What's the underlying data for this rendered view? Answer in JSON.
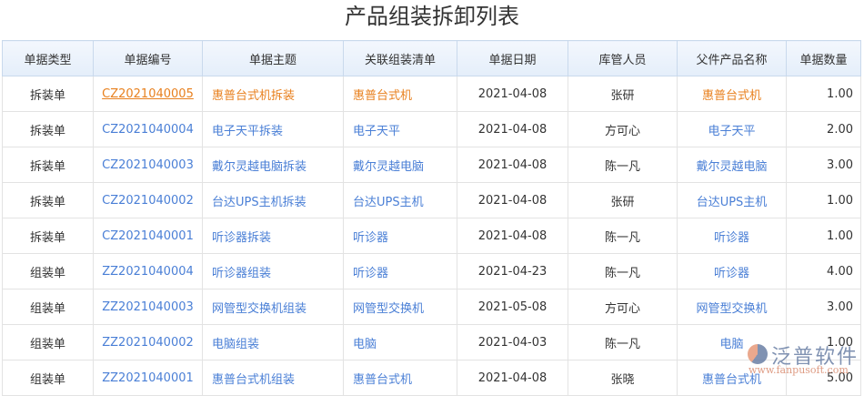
{
  "title": "产品组装拆卸列表",
  "columns": [
    "单据类型",
    "单据编号",
    "单据主题",
    "关联组装清单",
    "单据日期",
    "库管人员",
    "父件产品名称",
    "单据数量"
  ],
  "rows": [
    {
      "type": "拆装单",
      "no": "CZ2021040005",
      "subject": "惠普台式机拆装",
      "list": "惠普台式机",
      "date": "2021-04-08",
      "keeper": "张研",
      "parent": "惠普台式机",
      "qty": "1.00",
      "highlight": true
    },
    {
      "type": "拆装单",
      "no": "CZ2021040004",
      "subject": "电子天平拆装",
      "list": "电子天平",
      "date": "2021-04-08",
      "keeper": "方可心",
      "parent": "电子天平",
      "qty": "2.00"
    },
    {
      "type": "拆装单",
      "no": "CZ2021040003",
      "subject": "戴尔灵越电脑拆装",
      "list": "戴尔灵越电脑",
      "date": "2021-04-08",
      "keeper": "陈一凡",
      "parent": "戴尔灵越电脑",
      "qty": "3.00"
    },
    {
      "type": "拆装单",
      "no": "CZ2021040002",
      "subject": "台达UPS主机拆装",
      "list": "台达UPS主机",
      "date": "2021-04-08",
      "keeper": "张研",
      "parent": "台达UPS主机",
      "qty": "1.00"
    },
    {
      "type": "拆装单",
      "no": "CZ2021040001",
      "subject": "听诊器拆装",
      "list": "听诊器",
      "date": "2021-04-08",
      "keeper": "陈一凡",
      "parent": "听诊器",
      "qty": "1.00"
    },
    {
      "type": "组装单",
      "no": "ZZ2021040004",
      "subject": "听诊器组装",
      "list": "听诊器",
      "date": "2021-04-23",
      "keeper": "陈一凡",
      "parent": "听诊器",
      "qty": "4.00"
    },
    {
      "type": "组装单",
      "no": "ZZ2021040003",
      "subject": "网管型交换机组装",
      "list": "网管型交换机",
      "date": "2021-05-08",
      "keeper": "方可心",
      "parent": "网管型交换机",
      "qty": "3.00"
    },
    {
      "type": "组装单",
      "no": "ZZ2021040002",
      "subject": "电脑组装",
      "list": "电脑",
      "date": "2021-04-03",
      "keeper": "陈一凡",
      "parent": "电脑",
      "qty": "1.00"
    },
    {
      "type": "组装单",
      "no": "ZZ2021040001",
      "subject": "惠普台式机组装",
      "list": "惠普台式机",
      "date": "2021-04-08",
      "keeper": "张晓",
      "parent": "惠普台式机",
      "qty": "5.00"
    }
  ],
  "watermark": {
    "name": "泛普软件",
    "url": "www.fanpusoft.com"
  }
}
